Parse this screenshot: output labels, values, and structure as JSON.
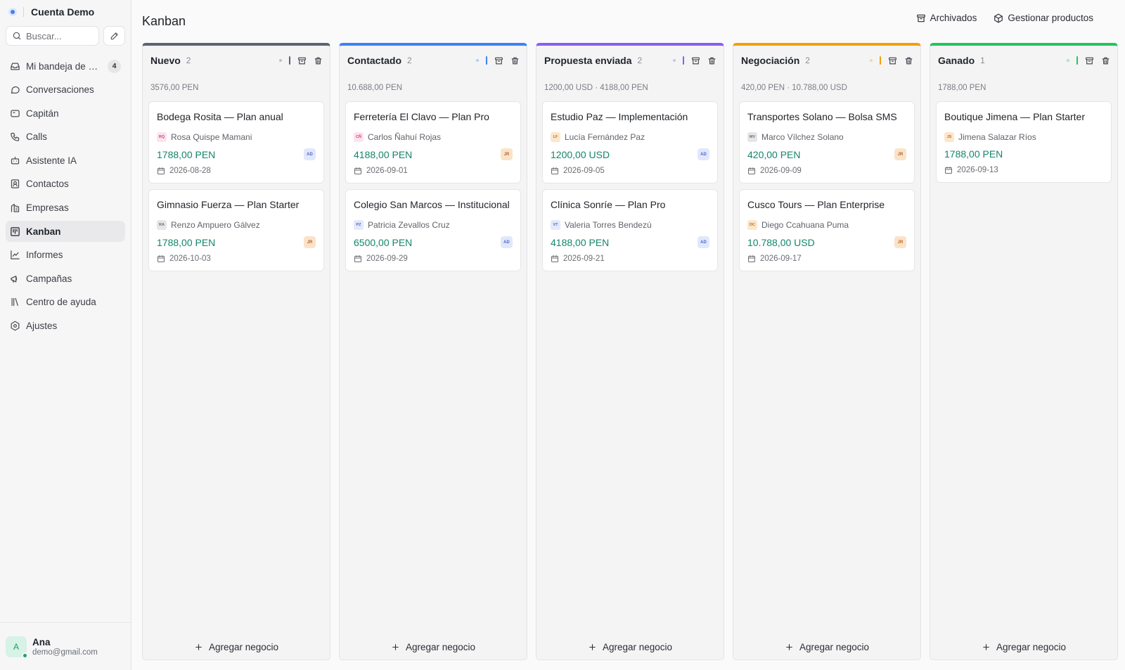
{
  "sidebar": {
    "account": "Cuenta Demo",
    "search_placeholder": "Buscar...",
    "nav": [
      {
        "label": "Mi bandeja de en...",
        "badge": "4",
        "icon": "inbox-icon"
      },
      {
        "label": "Conversaciones",
        "icon": "chat-icon"
      },
      {
        "label": "Capitán",
        "icon": "captain-icon"
      },
      {
        "label": "Calls",
        "icon": "phone-icon"
      },
      {
        "label": "Asistente IA",
        "icon": "bot-icon"
      },
      {
        "label": "Contactos",
        "icon": "contacts-icon"
      },
      {
        "label": "Empresas",
        "icon": "building-icon"
      },
      {
        "label": "Kanban",
        "icon": "kanban-icon",
        "active": true
      },
      {
        "label": "Informes",
        "icon": "chart-icon"
      },
      {
        "label": "Campañas",
        "icon": "megaphone-icon"
      },
      {
        "label": "Centro de ayuda",
        "icon": "library-icon"
      },
      {
        "label": "Ajustes",
        "icon": "settings-icon"
      }
    ],
    "user": {
      "initial": "A",
      "name": "Ana",
      "email": "demo@gmail.com"
    }
  },
  "header": {
    "title": "Kanban",
    "archived_label": "Archivados",
    "products_label": "Gestionar productos"
  },
  "add_deal_label": "Agregar negocio",
  "columns": [
    {
      "name": "Nuevo",
      "count": "2",
      "color": "#5b6474",
      "total": "3576,00 PEN",
      "cards": [
        {
          "title": "Bodega Rosita — Plan anual",
          "initials": "RQ",
          "initials_bg": "#fde3ef",
          "initials_fg": "#c4467d",
          "contact": "Rosa Quispe Mamani",
          "amount": "1788,00 PEN",
          "owner": "AD",
          "owner_type": "ad",
          "date": "2026-08-28"
        },
        {
          "title": "Gimnasio Fuerza — Plan Starter",
          "initials": "RA",
          "initials_bg": "#e6e6e9",
          "initials_fg": "#6b6e74",
          "contact": "Renzo Ampuero Gálvez",
          "amount": "1788,00 PEN",
          "owner": "JR",
          "owner_type": "jr",
          "date": "2026-10-03"
        }
      ]
    },
    {
      "name": "Contactado",
      "count": "2",
      "color": "#3b82f6",
      "total": "10.688,00 PEN",
      "cards": [
        {
          "title": "Ferretería El Clavo — Plan Pro",
          "initials": "CÑ",
          "initials_bg": "#fde3ef",
          "initials_fg": "#c4467d",
          "contact": "Carlos Ñahuí Rojas",
          "amount": "4188,00 PEN",
          "owner": "JR",
          "owner_type": "jr",
          "date": "2026-09-01"
        },
        {
          "title": "Colegio San Marcos — Institucional",
          "initials": "PZ",
          "initials_bg": "#e4e9fb",
          "initials_fg": "#5068c4",
          "contact": "Patricia Zevallos Cruz",
          "amount": "6500,00 PEN",
          "owner": "AD",
          "owner_type": "ad",
          "date": "2026-09-29"
        }
      ]
    },
    {
      "name": "Propuesta enviada",
      "count": "2",
      "color": "#8b5cf6",
      "total": "1200,00 USD · 4188,00 PEN",
      "cards": [
        {
          "title": "Estudio Paz — Implementación",
          "initials": "LF",
          "initials_bg": "#fde6cc",
          "initials_fg": "#b86f24",
          "contact": "Lucía Fernández Paz",
          "amount": "1200,00 USD",
          "owner": "AD",
          "owner_type": "ad",
          "date": "2026-09-05"
        },
        {
          "title": "Clínica Sonríe — Plan Pro",
          "initials": "VT",
          "initials_bg": "#e4e9fb",
          "initials_fg": "#5068c4",
          "contact": "Valeria Torres Bendezú",
          "amount": "4188,00 PEN",
          "owner": "AD",
          "owner_type": "ad",
          "date": "2026-09-21"
        }
      ]
    },
    {
      "name": "Negociación",
      "count": "2",
      "color": "#f59e0b",
      "total": "420,00 PEN · 10.788,00 USD",
      "cards": [
        {
          "title": "Transportes Solano — Bolsa SMS",
          "initials": "MV",
          "initials_bg": "#e6e6e9",
          "initials_fg": "#6b6e74",
          "contact": "Marco Vílchez Solano",
          "amount": "420,00 PEN",
          "owner": "JR",
          "owner_type": "jr",
          "date": "2026-09-09"
        },
        {
          "title": "Cusco Tours — Plan Enterprise",
          "initials": "DC",
          "initials_bg": "#fde6cc",
          "initials_fg": "#b86f24",
          "contact": "Diego Ccahuana Puma",
          "amount": "10.788,00 USD",
          "owner": "JR",
          "owner_type": "jr",
          "date": "2026-09-17"
        }
      ]
    },
    {
      "name": "Ganado",
      "count": "1",
      "color": "#22c55e",
      "total": "1788,00 PEN",
      "cards": [
        {
          "title": "Boutique Jimena — Plan Starter",
          "initials": "JS",
          "initials_bg": "#fde6cc",
          "initials_fg": "#b86f24",
          "contact": "Jimena Salazar Ríos",
          "amount": "1788,00 PEN",
          "owner": "",
          "owner_type": "none",
          "date": "2026-09-13"
        }
      ]
    }
  ]
}
